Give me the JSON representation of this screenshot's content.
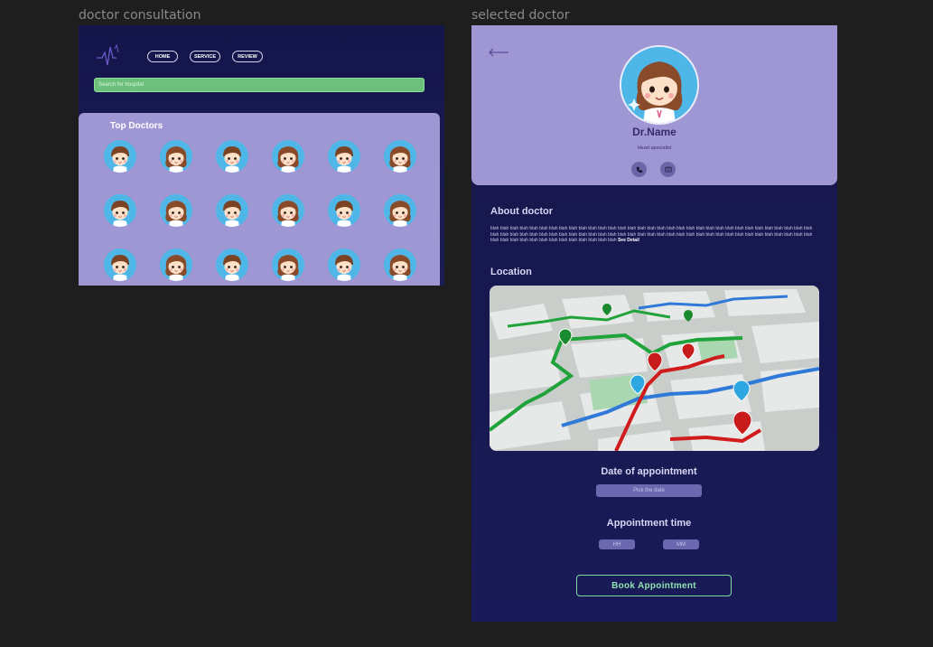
{
  "frames": {
    "consultation_label": "doctor consultation",
    "selected_label": "selected doctor"
  },
  "home": {
    "nav": [
      "HOME",
      "SERVICE",
      "REVIEW"
    ],
    "search_placeholder": "Search for hospital",
    "top_doctors_title": "Top Doctors",
    "doctor_grid": {
      "rows": 3,
      "cols": 6
    }
  },
  "profile": {
    "name": "Dr.Name",
    "specialty": "Heart specialist",
    "about_title": "About doctor",
    "about_text": "blah blah blah blah blah blah blah blah blah blah blah blah blah blah blah blah blah blah blah blah blah blah blah blah blah blah blah blah blah blah blah blah blah blah blah blah blah blah blah blah blah blah blah blah blah blah blah blah blah blah blah blah blah blah blah blah blah blah blah blah blah blah blah blah blah blah blah blah blah blah blah blah blah blah blah blah blah blah blah",
    "see_detail": "See Detail",
    "location_title": "Location",
    "date_title": "Date of appointment",
    "date_placeholder": "Pick the date",
    "time_title": "Appointment time",
    "hour_placeholder": "HH",
    "minute_placeholder": "MM",
    "book_label": "Book Appointment"
  },
  "colors": {
    "panel": "#9e97d4",
    "navy": "#16164a",
    "accent_green": "#6cc07b",
    "book_green": "#8ee2ae"
  },
  "icons": [
    "logo-heartbeat-icon",
    "back-arrow-icon",
    "phone-icon",
    "message-icon",
    "map-pin-icon"
  ]
}
